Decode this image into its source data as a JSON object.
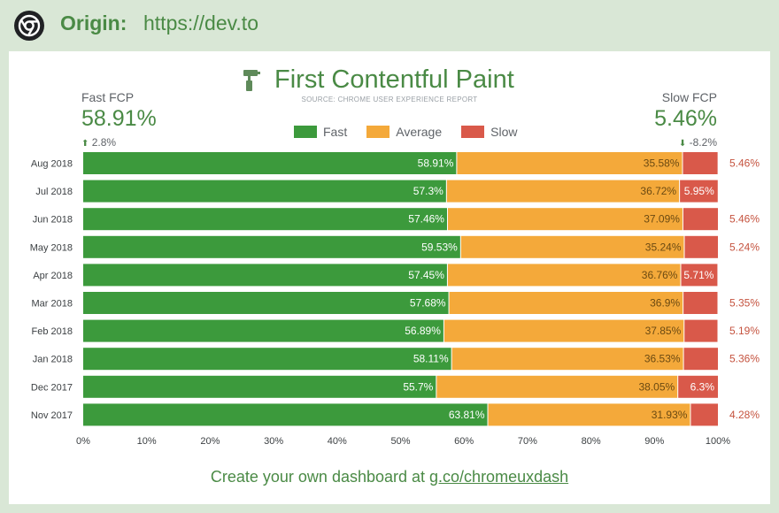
{
  "header": {
    "origin_label": "Origin:",
    "origin_url": "https://dev.to"
  },
  "card": {
    "title": "First Contentful Paint",
    "source": "SOURCE: CHROME USER EXPERIENCE REPORT",
    "fast_label": "Fast FCP",
    "fast_value": "58.91%",
    "fast_delta": "2.8%",
    "slow_label": "Slow FCP",
    "slow_value": "5.46%",
    "slow_delta": "-8.2%",
    "footer_text": "Create your own dashboard at ",
    "footer_link": "g.co/chromeuxdash"
  },
  "colors": {
    "fast": "#3c9a3c",
    "average": "#f4a93a",
    "slow": "#d9594a",
    "accent": "#4a8a45"
  },
  "chart_data": {
    "type": "bar",
    "orientation": "horizontal",
    "stacked": true,
    "categories": [
      "Aug 2018",
      "Jul 2018",
      "Jun 2018",
      "May 2018",
      "Apr 2018",
      "Mar 2018",
      "Feb 2018",
      "Jan 2018",
      "Dec 2017",
      "Nov 2017"
    ],
    "series": [
      {
        "name": "Fast",
        "values": [
          58.91,
          57.3,
          57.46,
          59.53,
          57.45,
          57.68,
          56.89,
          58.11,
          55.7,
          63.81
        ]
      },
      {
        "name": "Average",
        "values": [
          35.58,
          36.72,
          37.09,
          35.24,
          36.76,
          36.9,
          37.85,
          36.53,
          38.05,
          31.93
        ]
      },
      {
        "name": "Slow",
        "values": [
          5.46,
          5.95,
          5.46,
          5.24,
          5.71,
          5.35,
          5.19,
          5.36,
          6.3,
          4.28
        ]
      }
    ],
    "xlim": [
      0,
      100
    ],
    "xticks": [
      "0%",
      "10%",
      "20%",
      "30%",
      "40%",
      "50%",
      "60%",
      "70%",
      "80%",
      "90%",
      "100%"
    ],
    "legend_position": "top-center",
    "grid": false,
    "data_labels": [
      [
        "58.91%",
        "35.58%",
        "5.46%"
      ],
      [
        "57.3%",
        "36.72%",
        "5.95%"
      ],
      [
        "57.46%",
        "37.09%",
        "5.46%"
      ],
      [
        "59.53%",
        "35.24%",
        "5.24%"
      ],
      [
        "57.45%",
        "36.76%",
        "5.71%"
      ],
      [
        "57.68%",
        "36.9%",
        "5.35%"
      ],
      [
        "56.89%",
        "37.85%",
        "5.19%"
      ],
      [
        "58.11%",
        "36.53%",
        "5.36%"
      ],
      [
        "55.7%",
        "38.05%",
        "6.3%"
      ],
      [
        "63.81%",
        "31.93%",
        "4.28%"
      ]
    ],
    "slow_label_outside": [
      true,
      false,
      true,
      true,
      false,
      true,
      true,
      true,
      false,
      true
    ]
  }
}
